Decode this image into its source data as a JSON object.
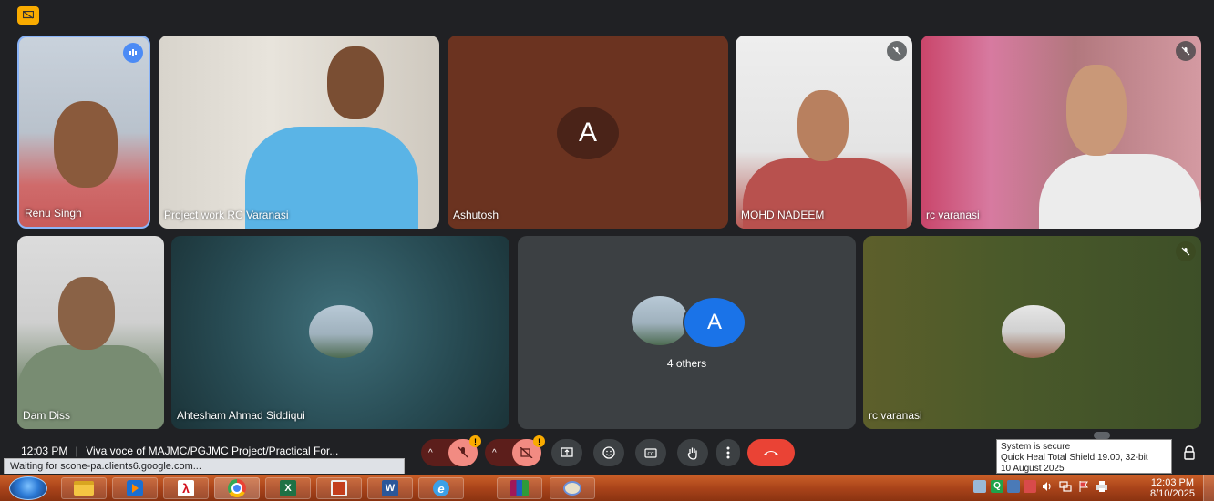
{
  "participants": {
    "renu": {
      "name": "Renu Singh"
    },
    "project": {
      "name": "Project work RC Varanasi"
    },
    "ashutosh": {
      "name": "Ashutosh",
      "initial": "A"
    },
    "mohd": {
      "name": "MOHD NADEEM"
    },
    "rcv1": {
      "name": "rc varanasi"
    },
    "dam": {
      "name": "Dam Diss"
    },
    "ahtesham": {
      "name": "Ahtesham Ahmad Siddiqui"
    },
    "others": {
      "label": "4 others",
      "initial": "A"
    },
    "rcv2": {
      "name": "rc varanasi"
    }
  },
  "toolbar": {
    "time": "12:03 PM",
    "separator": "|",
    "meeting_title": "Viva voce of MAJMC/PGJMC Project/Practical For..."
  },
  "browser_status": "Waiting for scone-pa.clients6.google.com...",
  "security_tooltip": {
    "line1": "System is secure",
    "line2": "Quick Heal Total Shield 19.00, 32-bit",
    "line3": "10 August 2025"
  },
  "taskbar": {
    "clock_time": "12:03 PM",
    "clock_date": "8/10/2025"
  }
}
